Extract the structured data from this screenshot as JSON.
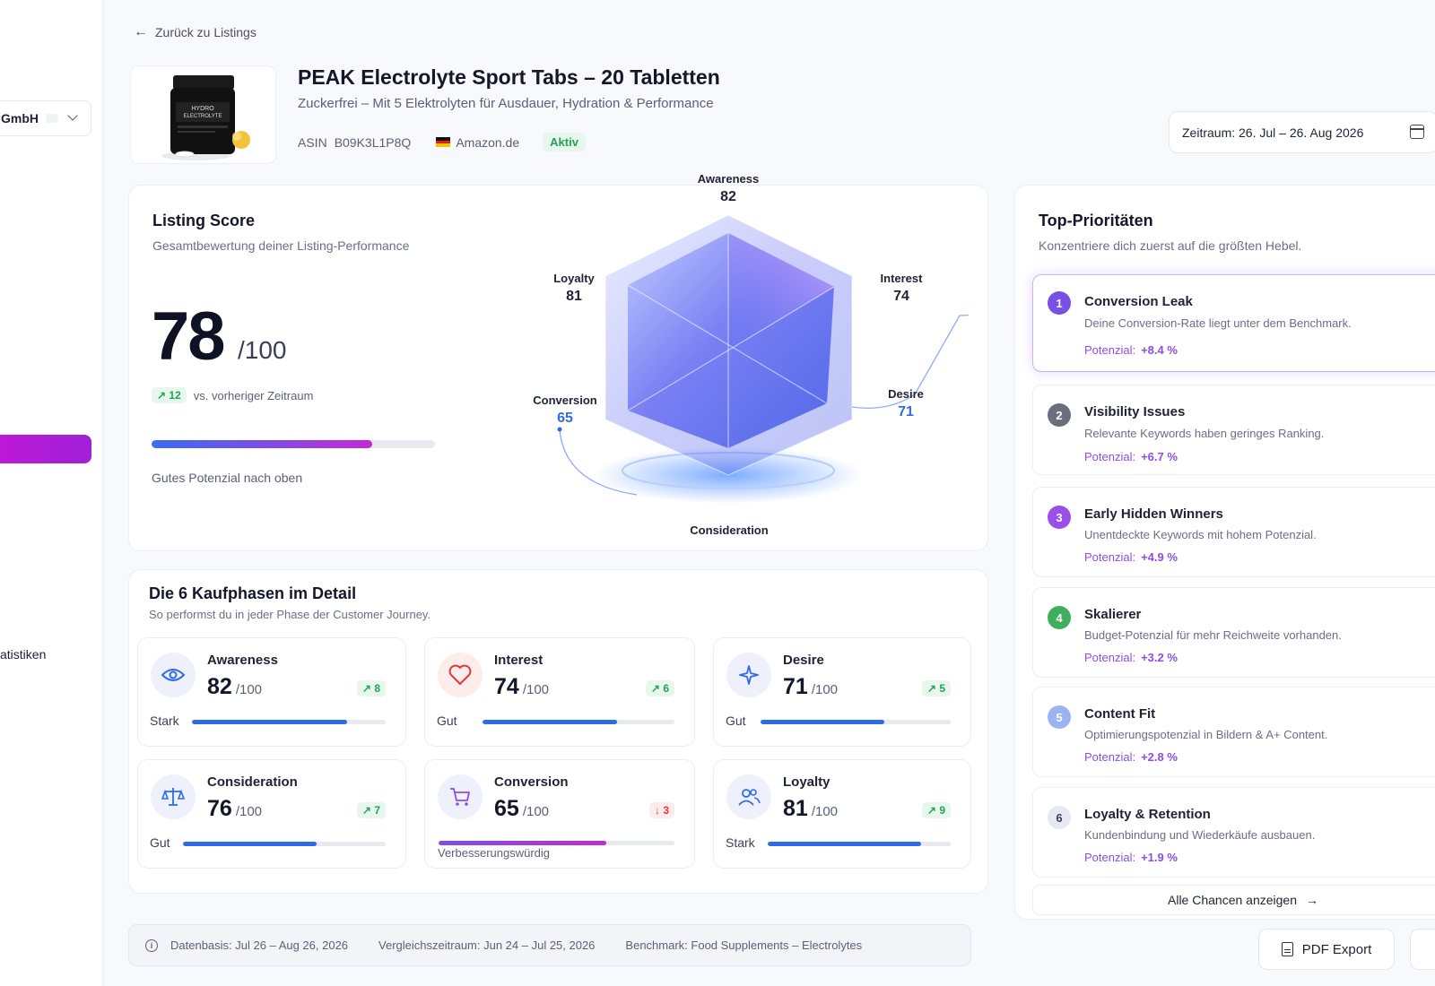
{
  "sidebar": {
    "org_name": "GmbH",
    "stat_label": "atistiken"
  },
  "header": {
    "back_label": "Zurück zu Listings",
    "product_title": "PEAK Electrolyte Sport Tabs – 20 Tabletten",
    "product_subtitle": "Zuckerfrei – Mit 5 Elektrolyten für Ausdauer, Hydration & Performance",
    "asin_label": "ASIN",
    "asin": "B09K3L1P8Q",
    "marketplace": "Amazon.de",
    "status": "Aktiv",
    "product_label_line1": "HYDRO",
    "product_label_line2": "ELECTROLYTE",
    "date_range": "Zeitraum: 26. Jul – 26. Aug 2026"
  },
  "score": {
    "title": "Listing Score",
    "subtitle": "Gesamtbewertung deiner Listing-Performance",
    "value": "78",
    "of": "/100",
    "value_fraction": 0.78,
    "delta": "12",
    "delta_label": "vs. vorheriger Zeitraum",
    "note": "Gutes Potenzial nach oben"
  },
  "radar": {
    "awareness_label": "Awareness",
    "awareness_value": "82",
    "interest_label": "Interest",
    "interest_value": "74",
    "desire_label": "Desire",
    "desire_value": "71",
    "consideration_label": "Consideration",
    "conversion_label": "Conversion",
    "conversion_value": "65",
    "loyalty_label": "Loyalty",
    "loyalty_value": "81"
  },
  "phases": {
    "title": "Die 6 Kaufphasen im Detail",
    "subtitle": "So performst du in jeder Phase der Customer Journey.",
    "of": "/100",
    "items": [
      {
        "name": "Awareness",
        "value": "82",
        "delta": "8",
        "level": "Stark",
        "fraction": 0.8
      },
      {
        "name": "Interest",
        "value": "74",
        "delta": "6",
        "level": "Gut",
        "fraction": 0.7
      },
      {
        "name": "Desire",
        "value": "71",
        "delta": "5",
        "level": "Gut",
        "fraction": 0.65
      },
      {
        "name": "Consideration",
        "value": "76",
        "delta": "7",
        "level": "Gut",
        "fraction": 0.66
      },
      {
        "name": "Conversion",
        "value": "65",
        "delta": "3",
        "level": "Verbesserungswürdig",
        "fraction": 0.71
      },
      {
        "name": "Loyalty",
        "value": "81",
        "delta": "9",
        "level": "Stark",
        "fraction": 0.84
      }
    ]
  },
  "footer": {
    "data_basis": "Datenbasis:  Jul 26 – Aug 26, 2026",
    "comparison": "Vergleichszeitraum:  Jun 24 – Jul 25, 2026",
    "benchmark": "Benchmark: Food Supplements – Electrolytes"
  },
  "priorities": {
    "title": "Top-Prioritäten",
    "subtitle": "Konzentriere dich zuerst auf die größten Hebel.",
    "potential_label": "Potenzial:",
    "items": [
      {
        "num": "1",
        "title": "Conversion Leak",
        "desc": "Deine Conversion-Rate liegt unter dem Benchmark.",
        "potential": "+8.4 %",
        "color": "#7a4fe6"
      },
      {
        "num": "2",
        "title": "Visibility Issues",
        "desc": "Relevante Keywords haben geringes Ranking.",
        "potential": "+6.7 %",
        "color": "#6b6f7d"
      },
      {
        "num": "3",
        "title": "Early Hidden Winners",
        "desc": "Unentdeckte Keywords mit hohem Potenzial.",
        "potential": "+4.9 %",
        "color": "#9a4fe6"
      },
      {
        "num": "4",
        "title": "Skalierer",
        "desc": "Budget-Potenzial für mehr Reichweite vorhanden.",
        "potential": "+3.2 %",
        "color": "#3fae5e"
      },
      {
        "num": "5",
        "title": "Content Fit",
        "desc": "Optimierungspotenzial in Bildern & A+ Content.",
        "potential": "+2.8 %",
        "color": "#9bb3f0"
      },
      {
        "num": "6",
        "title": "Loyalty & Retention",
        "desc": "Kundenbindung und Wiederkäufe ausbauen.",
        "potential": "+1.9 %",
        "color": "#e6e9f2"
      }
    ],
    "all_label": "Alle Chancen anzeigen"
  },
  "actions": {
    "pdf_label": "PDF Export"
  },
  "colors": {
    "accent_blue": "#2f6ae8",
    "accent_purple": "#8c4de8",
    "success": "#22a352",
    "danger": "#e0373a"
  }
}
